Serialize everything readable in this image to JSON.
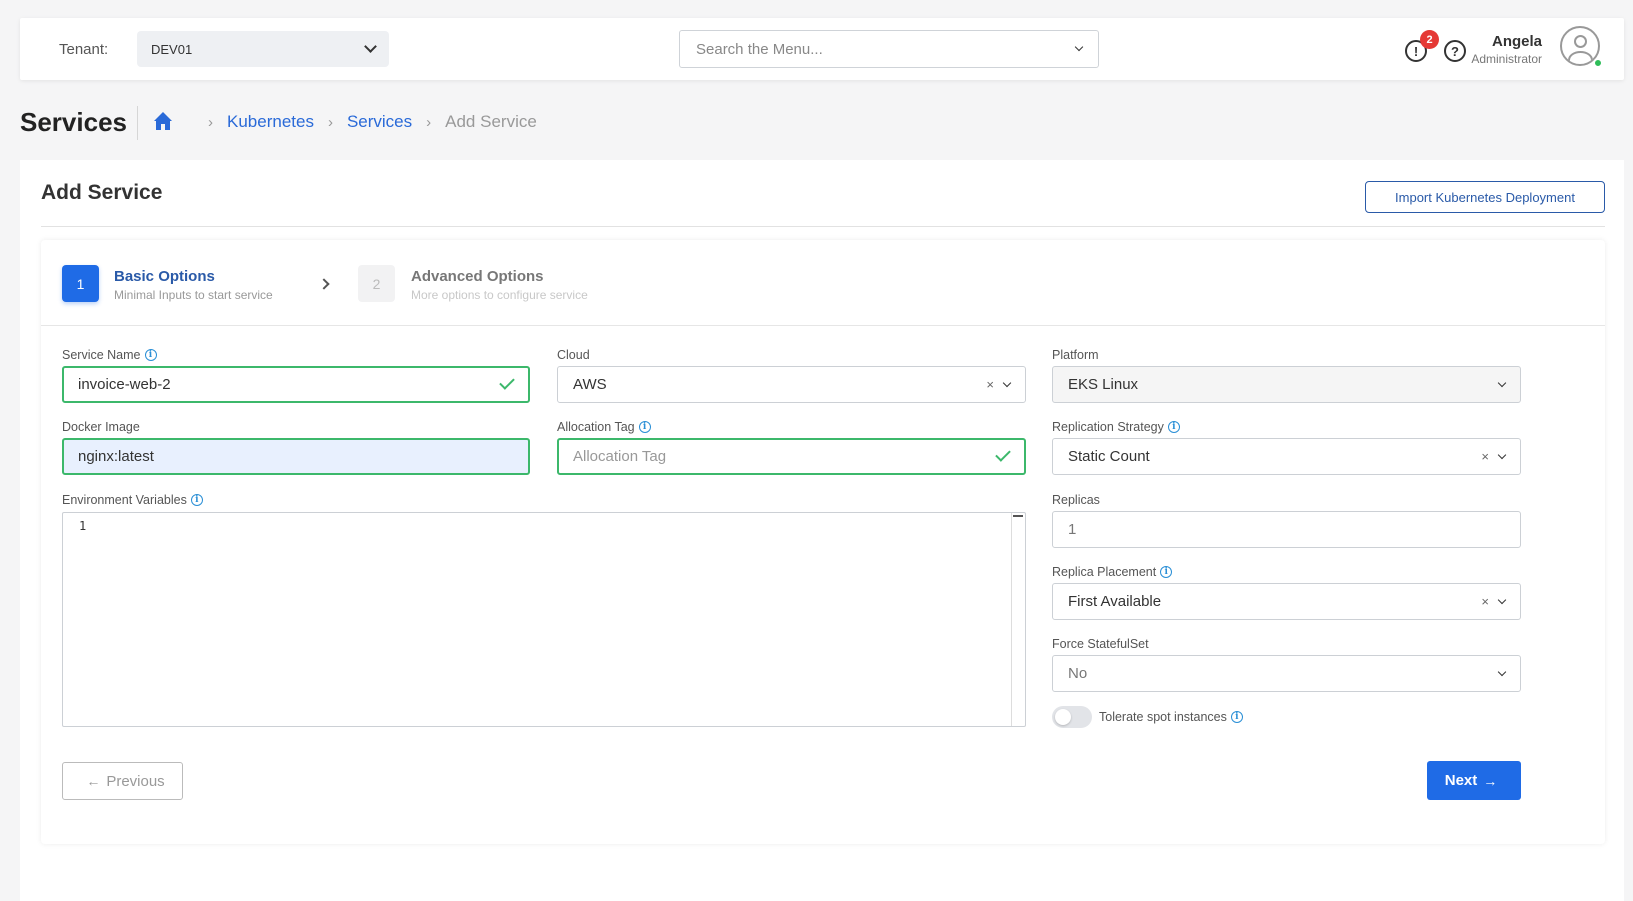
{
  "topbar": {
    "tenant_label": "Tenant:",
    "tenant_value": "DEV01",
    "search_placeholder": "Search the Menu...",
    "alert_count": "2",
    "alert_glyph": "!",
    "help_glyph": "?",
    "user": {
      "name": "Angela",
      "role": "Administrator"
    }
  },
  "page": {
    "title": "Services",
    "breadcrumb": [
      "Kubernetes",
      "Services",
      "Add Service"
    ]
  },
  "card": {
    "title": "Add Service",
    "import_button": "Import Kubernetes Deployment"
  },
  "steps": [
    {
      "number": "1",
      "title": "Basic Options",
      "subtitle": "Minimal Inputs to start service"
    },
    {
      "number": "2",
      "title": "Advanced Options",
      "subtitle": "More options to configure service"
    }
  ],
  "form": {
    "service_name": {
      "label": "Service Name",
      "value": "invoice-web-2"
    },
    "cloud": {
      "label": "Cloud",
      "value": "AWS"
    },
    "platform": {
      "label": "Platform",
      "value": "EKS Linux"
    },
    "docker_image": {
      "label": "Docker Image",
      "value": "nginx:latest"
    },
    "allocation_tag": {
      "label": "Allocation Tag",
      "placeholder": "Allocation Tag"
    },
    "replication_strategy": {
      "label": "Replication Strategy",
      "value": "Static Count"
    },
    "env_vars": {
      "label": "Environment Variables",
      "line_number": "1"
    },
    "replicas": {
      "label": "Replicas",
      "value": "1"
    },
    "replica_placement": {
      "label": "Replica Placement",
      "value": "First Available"
    },
    "force_statefulset": {
      "label": "Force StatefulSet",
      "value": "No"
    },
    "tolerate_spot": {
      "label": "Tolerate spot instances",
      "enabled": false
    }
  },
  "buttons": {
    "previous": "Previous",
    "next": "Next"
  },
  "colors": {
    "primary": "#1f6be6",
    "valid": "#3cb86b",
    "link": "#2a6ad8",
    "badge": "#e53935"
  }
}
